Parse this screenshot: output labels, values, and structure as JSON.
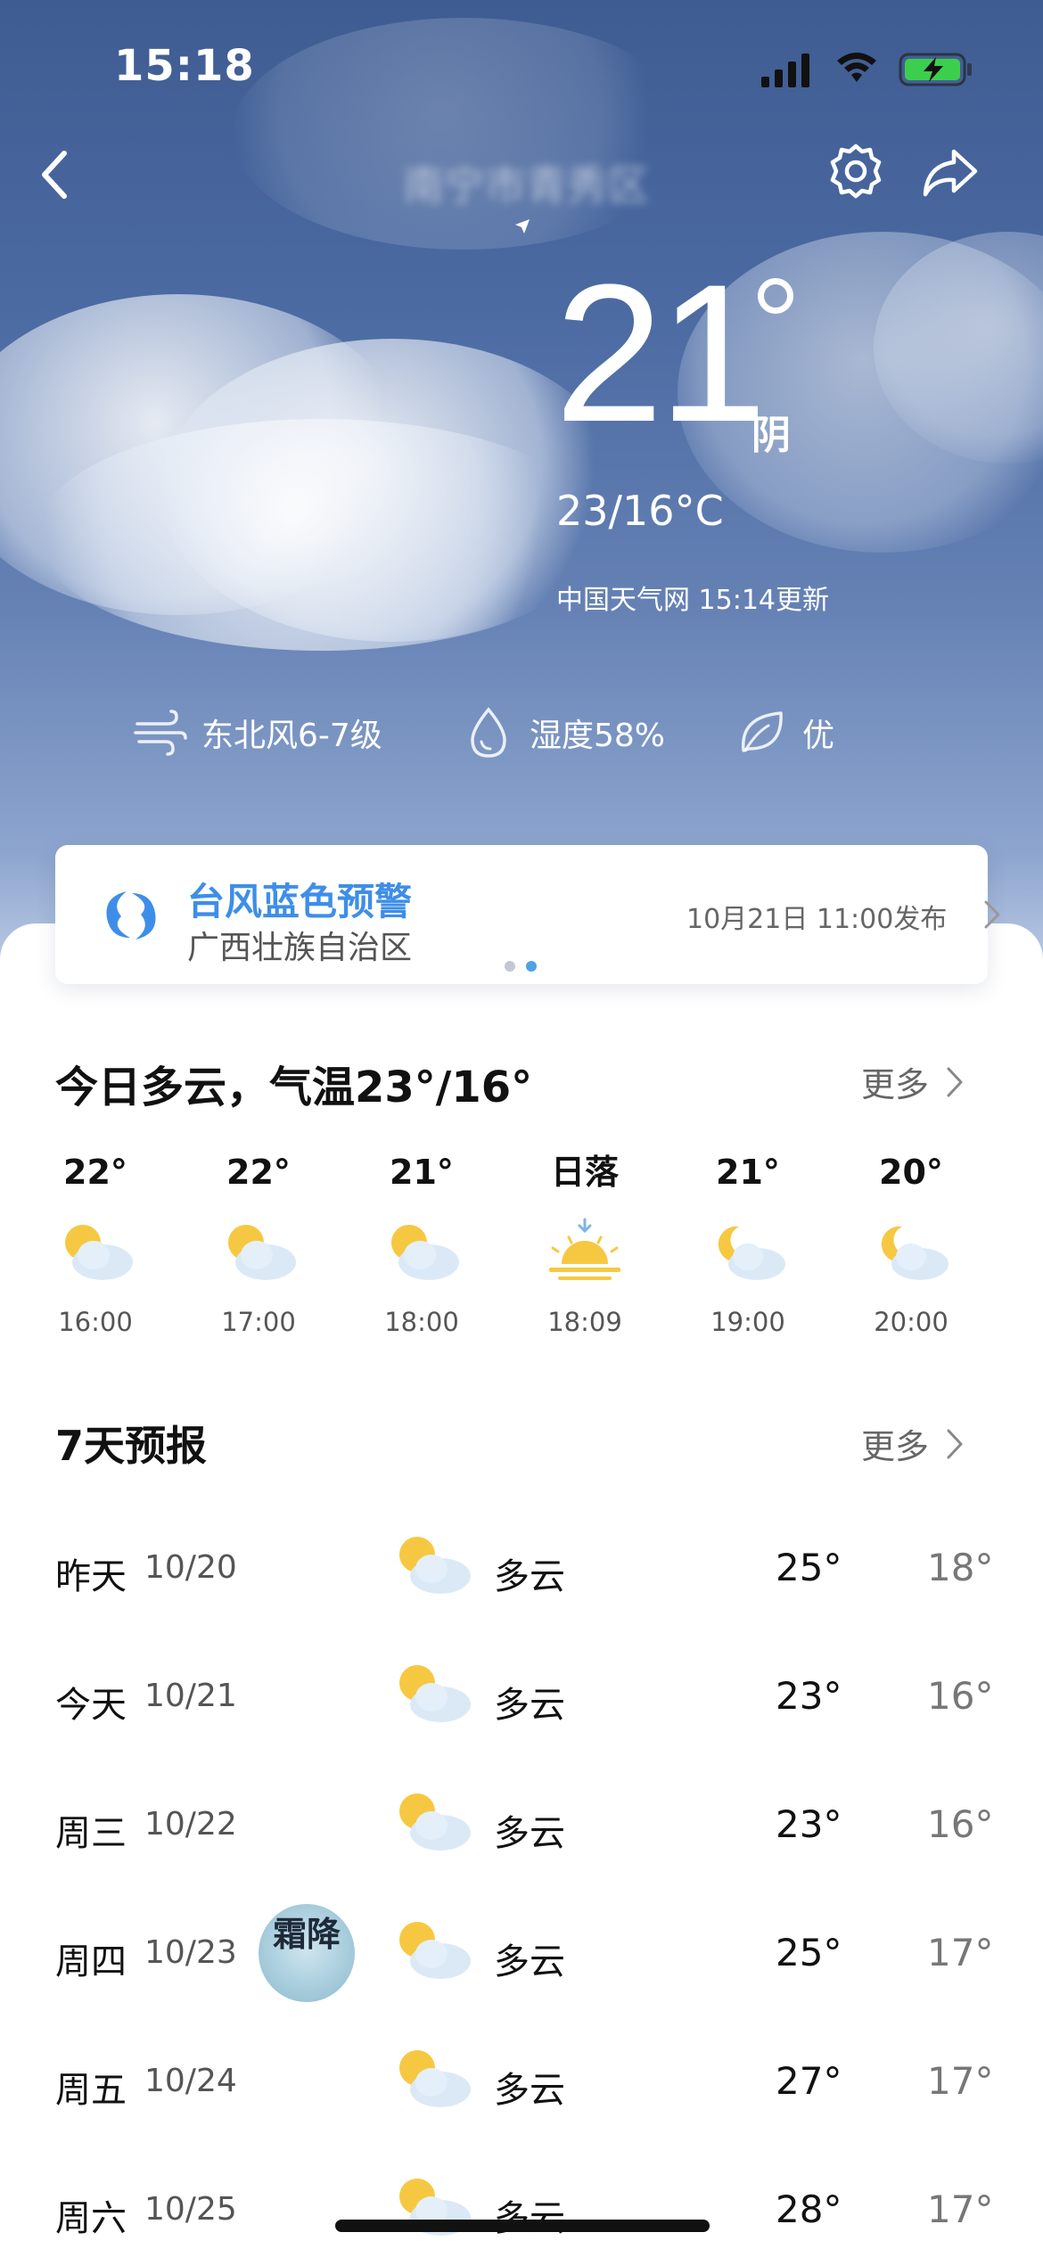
{
  "status_bar": {
    "time": "15:18",
    "icons": [
      "signal-icon",
      "wifi-icon",
      "battery-charging-icon"
    ]
  },
  "header": {
    "city": "南宁市青秀区",
    "icons": [
      "back-icon",
      "location-icon",
      "settings-icon",
      "share-icon"
    ]
  },
  "current": {
    "temperature": "21",
    "degree_symbol": "°",
    "condition": "阴",
    "range": "23/16°C",
    "source": "中国天气网 15:14更新"
  },
  "metrics": [
    {
      "icon": "wind-icon",
      "label": "东北风6-7级"
    },
    {
      "icon": "humidity-drop-icon",
      "label": "湿度58%"
    },
    {
      "icon": "leaf-icon",
      "label": "优"
    }
  ],
  "alert": {
    "icon": "typhoon-icon",
    "title": "台风蓝色预警",
    "region": "广西壮族自治区",
    "time": "10月21日 11:00发布",
    "pager": {
      "count": 2,
      "active_index": 1
    }
  },
  "today": {
    "title": "今日多云，气温23°/16°",
    "more_label": "更多",
    "hours": [
      {
        "temp": "22°",
        "time": "16:00",
        "icon": "partly-cloudy-day-icon"
      },
      {
        "temp": "22°",
        "time": "17:00",
        "icon": "partly-cloudy-day-icon"
      },
      {
        "temp": "21°",
        "time": "18:00",
        "icon": "partly-cloudy-day-icon"
      },
      {
        "temp": "日落",
        "time": "18:09",
        "icon": "sunset-icon"
      },
      {
        "temp": "21°",
        "time": "19:00",
        "icon": "partly-cloudy-night-icon"
      },
      {
        "temp": "20°",
        "time": "20:00",
        "icon": "partly-cloudy-night-icon"
      }
    ]
  },
  "week": {
    "title": "7天预报",
    "more_label": "更多",
    "days": [
      {
        "name": "昨天",
        "date": "10/20",
        "condition": "多云",
        "high": "25°",
        "low": "18°",
        "icon": "partly-cloudy-day-icon"
      },
      {
        "name": "今天",
        "date": "10/21",
        "condition": "多云",
        "high": "23°",
        "low": "16°",
        "icon": "partly-cloudy-day-icon"
      },
      {
        "name": "周三",
        "date": "10/22",
        "condition": "多云",
        "high": "23°",
        "low": "16°",
        "icon": "partly-cloudy-day-icon"
      },
      {
        "name": "周四",
        "date": "10/23",
        "condition": "多云",
        "high": "25°",
        "low": "17°",
        "icon": "partly-cloudy-day-icon"
      },
      {
        "name": "周五",
        "date": "10/24",
        "condition": "多云",
        "high": "27°",
        "low": "17°",
        "icon": "partly-cloudy-day-icon"
      },
      {
        "name": "周六",
        "date": "10/25",
        "condition": "多云",
        "high": "28°",
        "low": "17°",
        "icon": "partly-cloudy-day-icon"
      }
    ]
  },
  "solar_term_badge": {
    "text": "霜降"
  },
  "colors": {
    "sky_top": "#3f5c92",
    "sky_bottom": "#c9d6ea",
    "alert_blue": "#3e8ee8",
    "sun_yellow": "#f6c842",
    "cloud_blue": "#dbe9f6"
  }
}
